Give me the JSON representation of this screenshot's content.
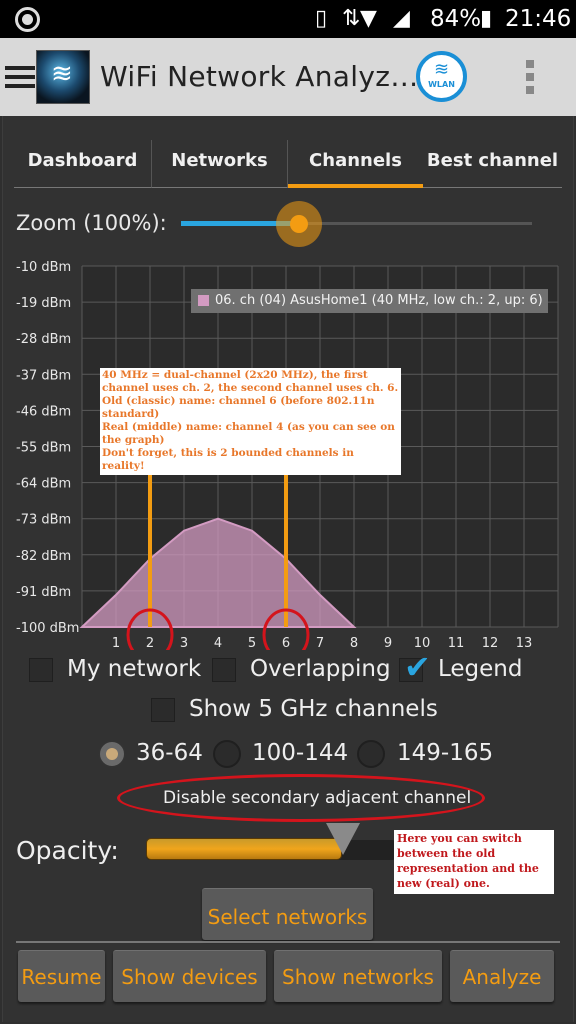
{
  "status_bar": {
    "battery": "84%",
    "time": "21:46"
  },
  "app_bar": {
    "title": "WiFi Network Analyz…",
    "wlan_badge": "WLAN",
    "icons": [
      "menu-icon",
      "app-logo-icon",
      "wlan-icon",
      "overflow-menu-icon"
    ]
  },
  "tabs": [
    "Dashboard",
    "Networks",
    "Channels",
    "Best channel"
  ],
  "active_tab": "Channels",
  "zoom": {
    "label": "Zoom (100%):",
    "level": 0.34
  },
  "chart_data": {
    "type": "area",
    "y_ticks": [
      "-10 dBm",
      "-19 dBm",
      "-28 dBm",
      "-37 dBm",
      "-46 dBm",
      "-55 dBm",
      "-64 dBm",
      "-73 dBm",
      "-82 dBm",
      "-91 dBm",
      "-100 dBm"
    ],
    "x_ticks": [
      "1",
      "2",
      "3",
      "4",
      "5",
      "6",
      "7",
      "8",
      "9",
      "10",
      "11",
      "12",
      "13"
    ],
    "ylim": [
      -100,
      -10
    ],
    "xlim": [
      0,
      14
    ],
    "grid": true,
    "series": [
      {
        "name": "06. ch (04) AsusHome1 (40 MHz, low ch.: 2, up: 6)",
        "color": "#d39bc2",
        "x": [
          0,
          1,
          2,
          3,
          4,
          5,
          6,
          7,
          8
        ],
        "y": [
          -100,
          -92,
          -83,
          -76,
          -73,
          -76,
          -83,
          -92,
          -100
        ]
      }
    ],
    "markers": [
      2,
      6
    ],
    "marker_color": "#f39c12",
    "circle_color": "#d4141c",
    "legend_placement": "top-right"
  },
  "annotation_top": [
    "40 MHz = dual-channel (2x20 MHz), the first",
    "channel uses ch. 2, the second channel uses ch. 6.",
    "Old (classic) name: channel 6 (before 802.11n",
    "standard)",
    "Real (middle) name: channel 4 (as you can see on",
    "the graph)",
    "Don't forget, this is 2 bounded channels in reality!"
  ],
  "checkboxes": {
    "my_network": {
      "label": "My network",
      "checked": false
    },
    "overlapping": {
      "label": "Overlapping",
      "checked": false
    },
    "legend": {
      "label": "Legend",
      "checked": true
    },
    "show_5ghz": {
      "label": "Show 5 GHz channels",
      "checked": false
    }
  },
  "radios": [
    {
      "label": "36-64",
      "selected": true
    },
    {
      "label": "100-144",
      "selected": false
    },
    {
      "label": "149-165",
      "selected": false
    }
  ],
  "secondary_channel_text": "Disable secondary adjacent channel",
  "opacity": {
    "label": "Opacity:",
    "level": 0.78
  },
  "annotation_bottom": [
    "Here you can switch",
    "between the old",
    "representation and the",
    "new (real) one."
  ],
  "buttons": {
    "select_networks": "Select networks",
    "resume": "Resume",
    "show_devices": "Show devices",
    "show_networks": "Show networks",
    "analyze": "Analyze"
  },
  "colors": {
    "accent": "#f39c12",
    "blue": "#2aa5e0",
    "annotation_red": "#d4141c"
  }
}
